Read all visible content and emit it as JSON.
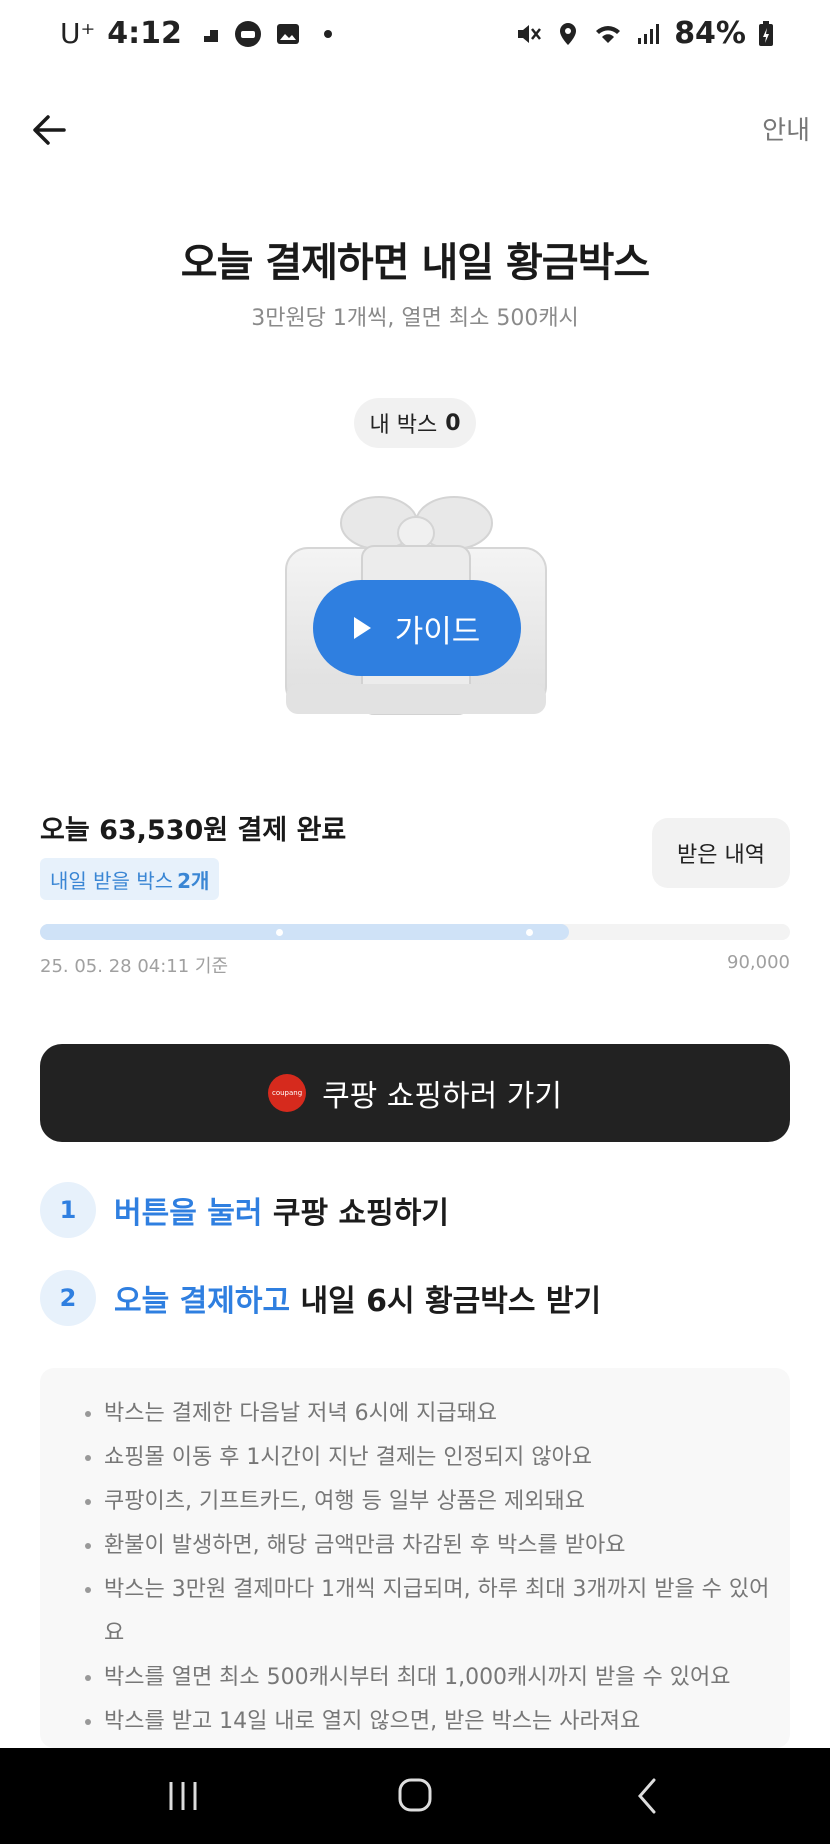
{
  "status_bar": {
    "carrier": "U⁺",
    "time": "4:12",
    "battery": "84%"
  },
  "header": {
    "guide_link": "안내"
  },
  "hero": {
    "title": "오늘 결제하면 내일 황금박스",
    "subtitle": "3만원당 1개씩, 열면 최소 500캐시",
    "my_box_label": "내 박스",
    "my_box_count": "0",
    "guide_button": "가이드"
  },
  "payment": {
    "paid_text": "오늘 63,530원 결제 완료",
    "tomorrow_label": "내일 받을 박스",
    "tomorrow_count": "2개",
    "received_button": "받은 내역",
    "progress_value": 63530,
    "progress_max": 90000,
    "progress_date": "25. 05. 28 04:11 기준",
    "progress_max_label": "90,000"
  },
  "shop_button": {
    "logo_text": "coupang",
    "label": "쿠팡 쇼핑하러 가기"
  },
  "steps": [
    {
      "num": "1",
      "highlight": "버튼을 눌러",
      "text": " 쿠팡 쇼핑하기"
    },
    {
      "num": "2",
      "highlight": "오늘 결제하고",
      "text": " 내일 6시 황금박스 받기"
    }
  ],
  "notes": [
    "박스는 결제한 다음날 저녁 6시에 지급돼요",
    "쇼핑몰 이동 후 1시간이 지난 결제는 인정되지 않아요",
    "쿠팡이츠, 기프트카드, 여행 등 일부 상품은 제외돼요",
    "환불이 발생하면, 해당 금액만큼 차감된 후 박스를 받아요",
    "박스는 3만원 결제마다 1개씩 지급되며, 하루 최대 3개까지 받을 수 있어요",
    "박스를 열면 최소 500캐시부터 최대 1,000캐시까지 받을 수 있어요",
    "박스를 받고 14일 내로 열지 않으면, 받은 박스는 사라져요"
  ],
  "colors": {
    "accent": "#2f7fe0",
    "dark_button": "#222222",
    "badge_bg": "#e7f1fb"
  },
  "icons": {
    "back": "arrow-left-icon",
    "play": "play-icon",
    "gift": "gift-box-icon"
  }
}
